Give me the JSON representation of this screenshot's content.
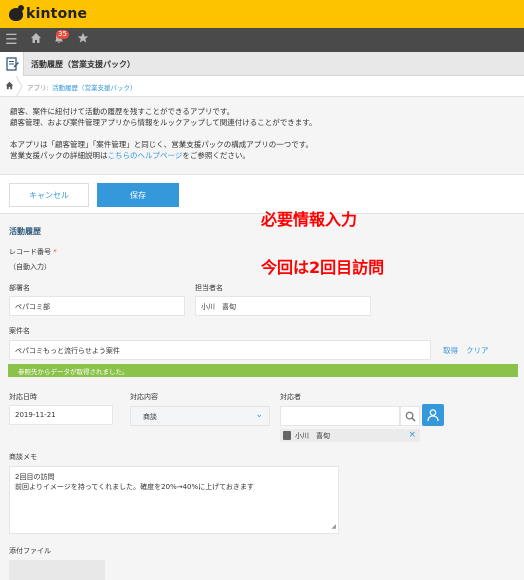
{
  "app": {
    "brand": "kintone",
    "notification_count": "35",
    "title": "活動履歴（営業支援パック）"
  },
  "breadcrumb": {
    "label": "アプリ:",
    "link": "活動履歴（営業支援パック）"
  },
  "description": {
    "line1": "顧客、案件に紐付けて活動の履歴を残すことができるアプリです。",
    "line2": "顧客管理、および案件管理アプリから情報をルックアップして関連付けることができます。",
    "line3": "本アプリは「顧客管理」「案件管理」と同じく、営業支援パックの構成アプリの一つです。",
    "line4_before": "営業支援パックの詳細説明は",
    "line4_link": "こちらのヘルプページ",
    "line4_after": "をご参照ください。"
  },
  "actions": {
    "cancel": "キャンセル",
    "save": "保存"
  },
  "form": {
    "section_title": "活動履歴",
    "record_number_label": "レコード番号",
    "record_number_required": "*",
    "record_number_value": "（自動入力）",
    "company_label": "部署名",
    "company_value": "ペパコミ部",
    "owner_label": "担当者名",
    "owner_value": "小川　喜旬",
    "case_label": "案件名",
    "case_value": "ペパコミもっと流行らせよう案件",
    "lookup_get": "取得",
    "lookup_clear": "クリア",
    "lookup_success": "参照先からデータが取得されました。",
    "date_label": "対応日時",
    "date_value": "2019-11-21",
    "content_label": "対応内容",
    "content_value": "商談",
    "person_label": "対応者",
    "person_chip": "小川　喜旬",
    "memo_label": "商談メモ",
    "memo_line1": "2回目の訪問",
    "memo_line2": "前回よりイメージを持ってくれました。確度を20%→40%に上げておきます",
    "attachment_label": "添付ファイル"
  },
  "annotations": {
    "line1": "必要情報入力",
    "line2": "今回は2回目訪問"
  },
  "colors": {
    "brand_yellow": "#fdc300",
    "accent_blue": "#3498db",
    "annotation_red": "#ff0000",
    "success_green": "#8bc34a"
  }
}
